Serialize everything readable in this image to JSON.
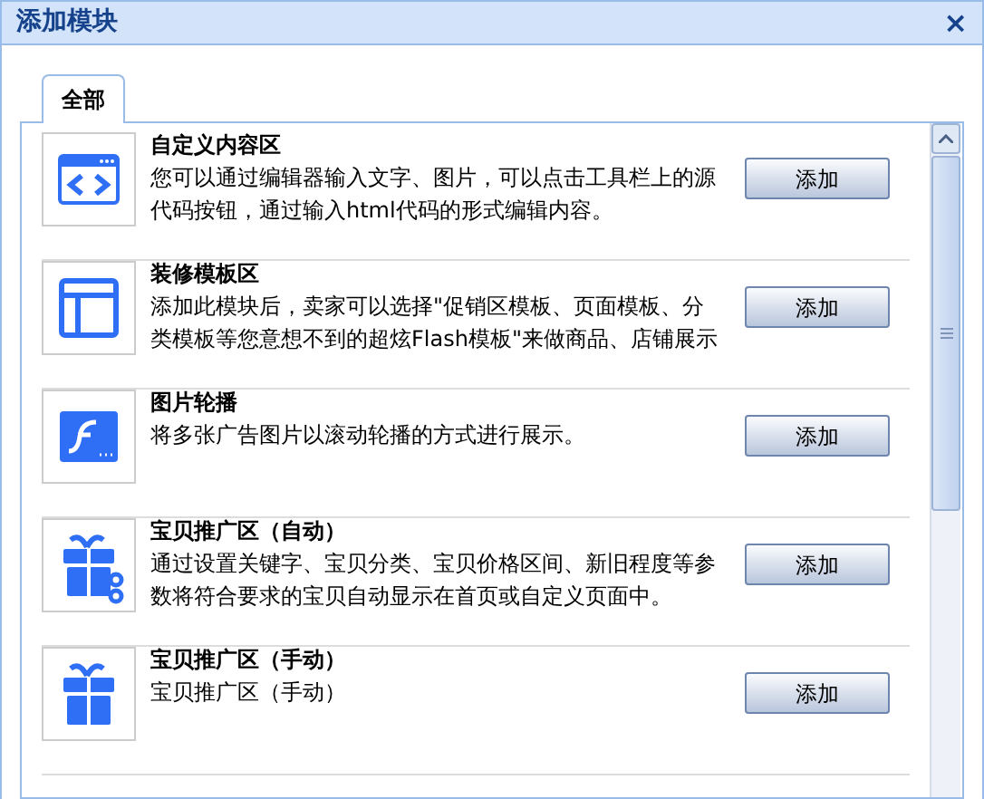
{
  "window": {
    "title": "添加模块",
    "close": "×"
  },
  "tabs": [
    {
      "label": "全部",
      "selected": true
    }
  ],
  "modules": [
    {
      "kind": "code",
      "title": "自定义内容区",
      "description": "您可以通过编辑器输入文字、图片，可以点击工具栏上的源代码按钮，通过输入html代码的形式编辑内容。",
      "button": "添加"
    },
    {
      "kind": "layout",
      "title": "装修模板区",
      "description": "添加此模块后，卖家可以选择\"促销区模板、页面模板、分类模板等您意想不到的超炫Flash模板\"来做商品、店铺展示",
      "button": "添加"
    },
    {
      "kind": "flash",
      "title": "图片轮播",
      "description": "将多张广告图片以滚动轮播的方式进行展示。",
      "button": "添加"
    },
    {
      "kind": "gift-gear",
      "title": "宝贝推广区（自动）",
      "description": "通过设置关键字、宝贝分类、宝贝价格区间、新旧程度等参数将符合要求的宝贝自动显示在首页或自定义页面中。",
      "button": "添加"
    },
    {
      "kind": "gift",
      "title": "宝贝推广区（手动）",
      "description": "宝贝推广区（手动）",
      "button": "添加"
    }
  ]
}
